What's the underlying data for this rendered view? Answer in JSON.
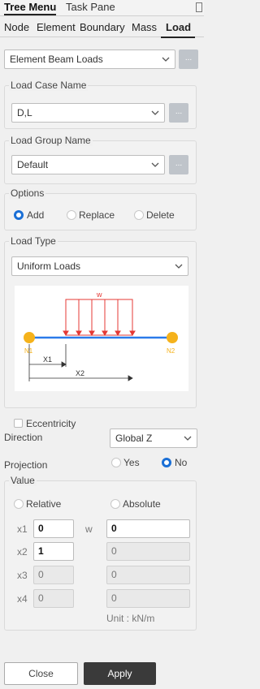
{
  "top_tabs": [
    "Tree Menu",
    "Task Pane"
  ],
  "sub_tabs": [
    "Node",
    "Element",
    "Boundary",
    "Mass",
    "Load"
  ],
  "load_type_select": "Element Beam Loads",
  "dots": "...",
  "load_case": {
    "title": "Load Case Name",
    "value": "D,L"
  },
  "load_group": {
    "title": "Load Group Name",
    "value": "Default"
  },
  "options": {
    "title": "Options",
    "items": [
      "Add",
      "Replace",
      "Delete"
    ],
    "selected": "Add"
  },
  "load_type": {
    "title": "Load Type",
    "value": "Uniform Loads",
    "diagram": {
      "w": "w",
      "n1": "N1",
      "n2": "N2",
      "x1": "X1",
      "x2": "X2"
    }
  },
  "eccentricity": "Eccentricity",
  "direction": {
    "label": "Direction",
    "value": "Global Z"
  },
  "projection": {
    "label": "Projection",
    "yes": "Yes",
    "no": "No",
    "selected": "No"
  },
  "value": {
    "title": "Value",
    "relative": "Relative",
    "absolute": "Absolute",
    "w_label": "w",
    "rows": [
      {
        "label": "x1",
        "x": "0",
        "w": "0"
      },
      {
        "label": "x2",
        "x": "1",
        "w": "0"
      },
      {
        "label": "x3",
        "x": "0",
        "w": "0"
      },
      {
        "label": "x4",
        "x": "0",
        "w": "0"
      }
    ],
    "unit": "Unit :  kN/m"
  },
  "buttons": {
    "close": "Close",
    "apply": "Apply"
  },
  "colors": {
    "accent": "#1a6fd6",
    "beam": "#2b7bea",
    "load": "#e53935",
    "node": "#f5b21b"
  }
}
